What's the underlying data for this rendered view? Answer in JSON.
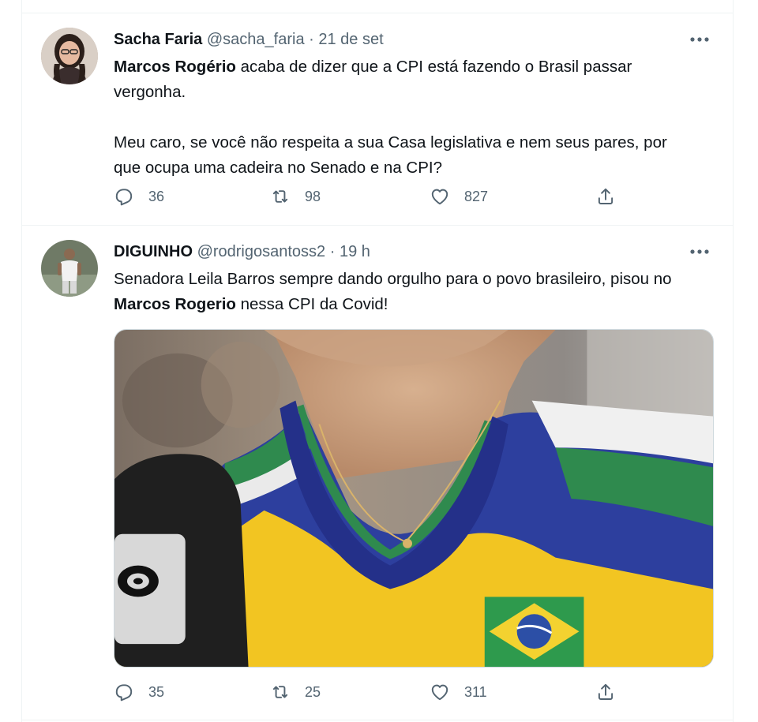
{
  "tweets": [
    {
      "display_name": "Sacha Faria",
      "handle": "@sacha_faria",
      "separator": "·",
      "timestamp": "21 de set",
      "text_line1_bold": "Marcos Rogério",
      "text_line1_rest": " acaba de dizer que a CPI está fazendo o Brasil passar vergonha.",
      "text_paragraph2": "Meu caro, se você não respeita a sua Casa legislativa e nem seus pares, por que ocupa uma cadeira no Senado e na CPI?",
      "replies": "36",
      "retweets": "98",
      "likes": "827"
    },
    {
      "display_name": "DIGUINHO",
      "handle": "@rodrigosantoss2",
      "separator": "·",
      "timestamp": "19 h",
      "text_start": "Senadora Leila Barros sempre dando orgulho para o povo brasileiro, pisou no ",
      "text_bold": "Marcos Rogerio",
      "text_end": " nessa CPI da Covid!",
      "replies": "35",
      "retweets": "25",
      "likes": "311"
    }
  ],
  "icons": {
    "more": "more-horizontal-icon",
    "reply": "reply-icon",
    "retweet": "retweet-icon",
    "like": "heart-icon",
    "share": "share-icon"
  },
  "colors": {
    "secondary_text": "#536471",
    "divider": "#eff3f4",
    "primary_text": "#0f1419"
  }
}
